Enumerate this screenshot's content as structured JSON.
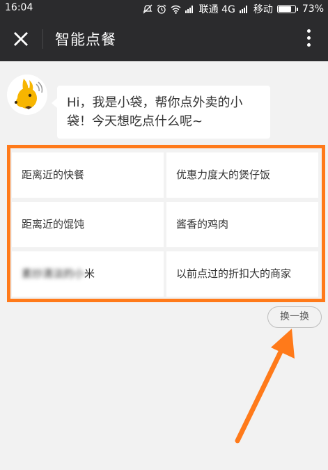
{
  "status_bar": {
    "time": "16:04",
    "carrier1": "联通 4G",
    "carrier2": "移动",
    "battery": "73%",
    "battery_level": 0.73,
    "icons": [
      "mute-icon",
      "alarm-icon",
      "wifi-icon",
      "signal-icon",
      "battery-icon"
    ]
  },
  "header": {
    "title": "智能点餐",
    "close_icon": "close-icon",
    "more_icon": "more-vertical-icon"
  },
  "chat": {
    "message": "Hi，我是小袋，帮你点外卖的小袋！今天想吃点什么呢~"
  },
  "suggestions": [
    {
      "label": "距离近的快餐"
    },
    {
      "label": "优惠力度大的煲仔饭"
    },
    {
      "label": "距离近的馄饨"
    },
    {
      "label": "酱香的鸡肉"
    },
    {
      "label_blurred": "素炒清淡的小",
      "label": "米"
    },
    {
      "label": "以前点过的折扣大的商家"
    }
  ],
  "refresh_label": "换一换",
  "colors": {
    "header_bg": "#2b2b2d",
    "page_bg": "#f2f2f2",
    "highlight": "#ff7a1a"
  }
}
